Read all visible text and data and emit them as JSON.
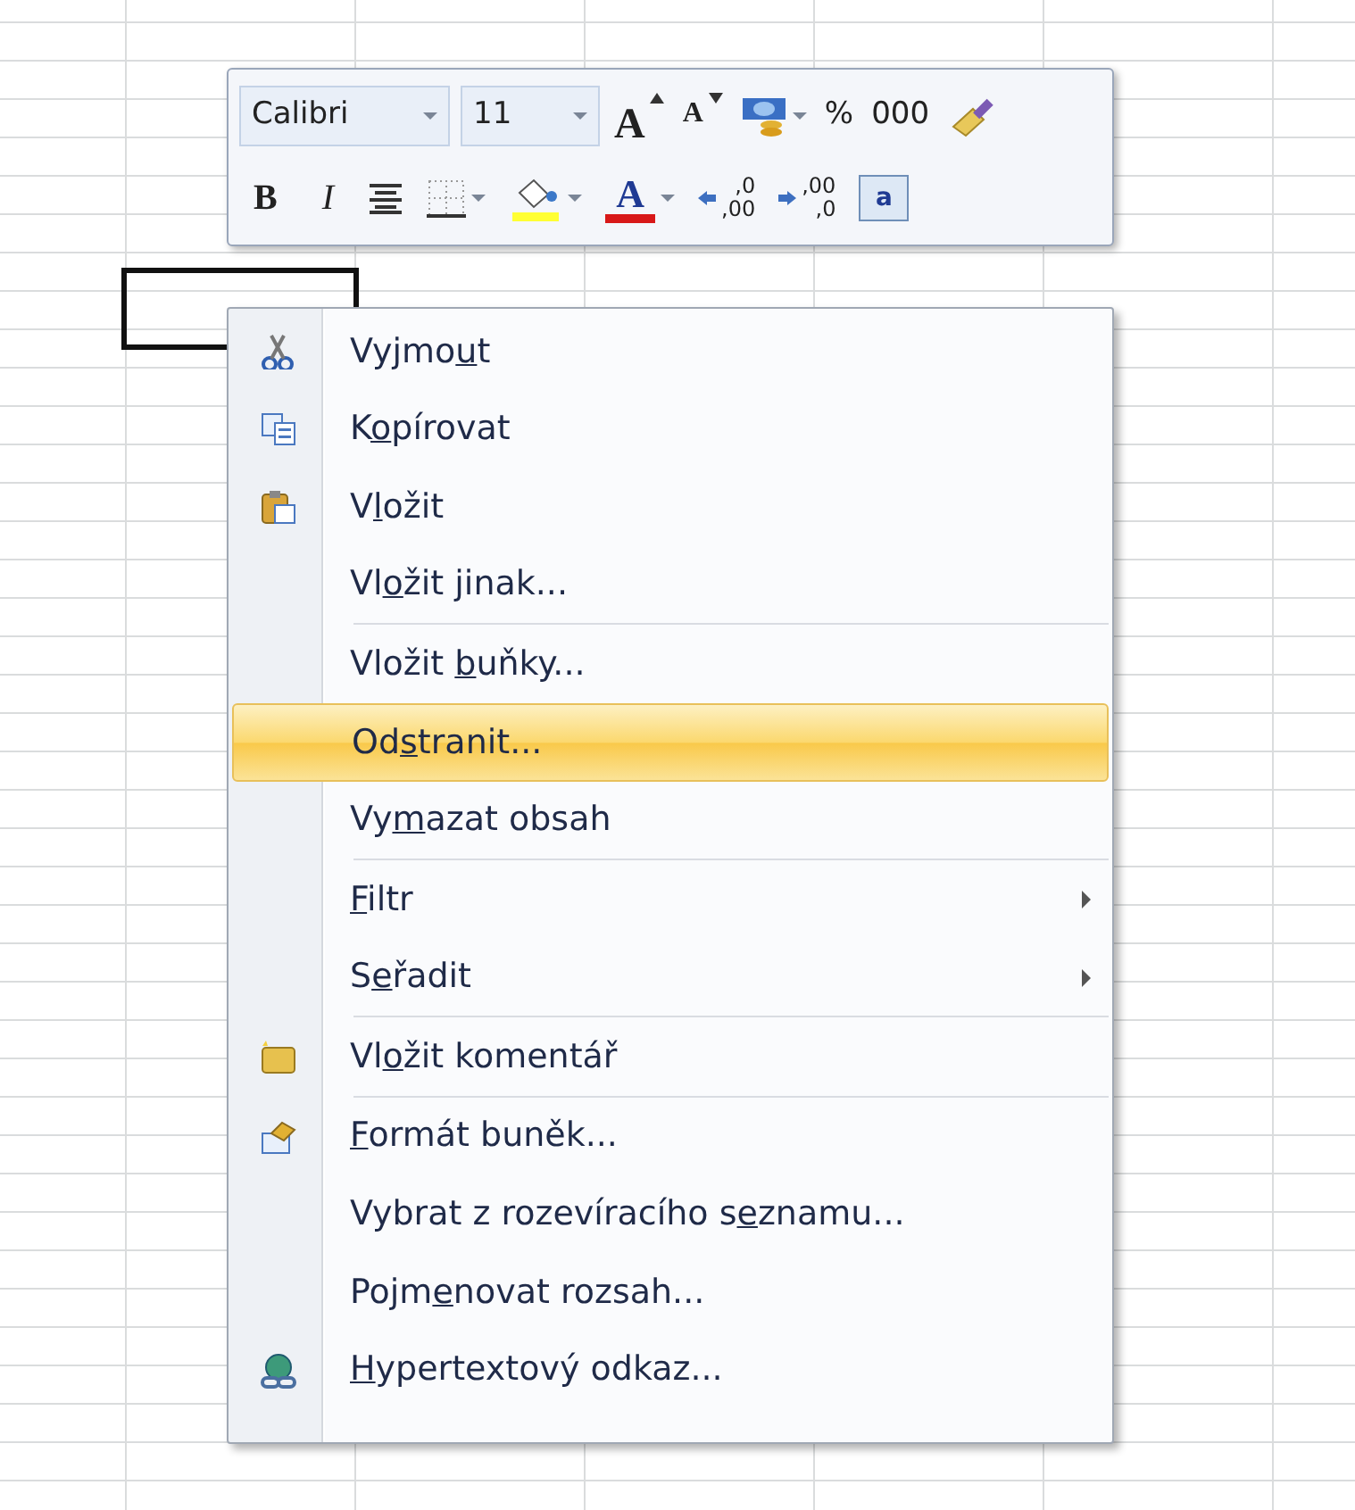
{
  "mini_toolbar": {
    "rows": [
      {
        "buttons": [
          {
            "kind": "font-name",
            "label": "Calibri"
          },
          {
            "kind": "font-size",
            "label": "11"
          },
          {
            "kind": "grow-font",
            "label": "A"
          },
          {
            "kind": "shrink-font",
            "label": "A"
          },
          {
            "kind": "accounting",
            "dropdown": true
          },
          {
            "kind": "text",
            "label": "%"
          },
          {
            "kind": "text",
            "label": "000"
          },
          {
            "kind": "painter"
          }
        ]
      },
      {
        "buttons": [
          {
            "kind": "bold",
            "label": "B"
          },
          {
            "kind": "italic",
            "label": "I"
          },
          {
            "kind": "center"
          },
          {
            "kind": "borders",
            "dropdown": true
          },
          {
            "kind": "fill",
            "dropdown": true,
            "color": "#ffff33"
          },
          {
            "kind": "font-color",
            "label": "A",
            "dropdown": true,
            "color": "#d81818"
          },
          {
            "kind": "increase-decimal",
            "top": ",0",
            "bottom": ",00"
          },
          {
            "kind": "decrease-decimal",
            "top": ",00",
            "bottom": ",0"
          },
          {
            "kind": "merge",
            "label": "a"
          }
        ]
      }
    ]
  },
  "context_menu": {
    "items": [
      {
        "kind": "cut",
        "before": "Vyjmo",
        "key": "u",
        "after": "t",
        "selected": false
      },
      {
        "kind": "copy",
        "before": "K",
        "key": "o",
        "after": "pírovat",
        "selected": false
      },
      {
        "kind": "paste",
        "before": "V",
        "key": "l",
        "after": "ožit",
        "selected": false
      },
      {
        "kind": "plain",
        "before": "Vl",
        "key": "o",
        "after": "žit jinak...",
        "selected": false
      },
      {
        "kind": "separator"
      },
      {
        "kind": "plain",
        "before": "Vložit ",
        "key": "b",
        "after": "uňky...",
        "selected": false
      },
      {
        "kind": "plain",
        "before": "Od",
        "key": "s",
        "after": "tranit...",
        "selected": true
      },
      {
        "kind": "plain",
        "before": "Vy",
        "key": "m",
        "after": "azat obsah",
        "selected": false
      },
      {
        "kind": "separator"
      },
      {
        "kind": "plain",
        "key": "F",
        "after": "iltr",
        "submenu": true,
        "selected": false
      },
      {
        "kind": "plain",
        "before": "S",
        "key": "e",
        "after": "řadit",
        "submenu": true,
        "selected": false
      },
      {
        "kind": "separator"
      },
      {
        "kind": "comment",
        "before": "Vl",
        "key": "o",
        "after": "žit komentář",
        "selected": false
      },
      {
        "kind": "separator"
      },
      {
        "kind": "format",
        "key": "F",
        "after": "ormát buněk...",
        "selected": false
      },
      {
        "kind": "plain",
        "before": "Vybrat z rozevíracího s",
        "key": "e",
        "after": "znamu...",
        "selected": false
      },
      {
        "kind": "plain",
        "before": "Pojm",
        "key": "e",
        "after": "novat rozsah...",
        "selected": false
      },
      {
        "kind": "hyperlink",
        "key": "H",
        "after": "ypertextový odkaz...",
        "selected": false
      }
    ]
  }
}
